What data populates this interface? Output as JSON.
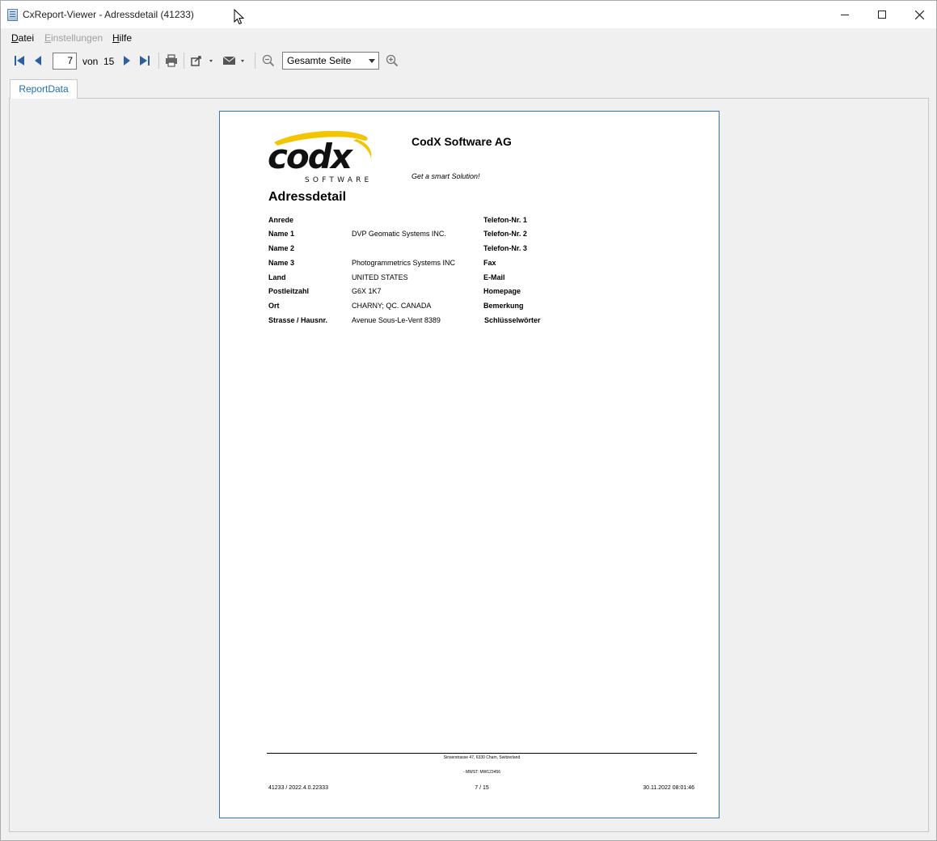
{
  "window": {
    "title": "CxReport-Viewer - Adressdetail (41233)"
  },
  "menu": {
    "datei_first": "D",
    "datei_rest": "atei",
    "einstellungen_first": "E",
    "einstellungen_rest": "instellungen",
    "hilfe_first": "H",
    "hilfe_rest": "ilfe"
  },
  "toolbar": {
    "current_page": "7",
    "von_label": "von",
    "total_pages": "15",
    "zoom_value": "Gesamte Seite",
    "icons": [
      "first-page-icon",
      "previous-page-icon",
      "next-page-icon",
      "last-page-icon",
      "print-icon",
      "export-icon",
      "email-icon",
      "zoom-out-icon",
      "zoom-in-icon"
    ]
  },
  "tabs": [
    {
      "label": "ReportData"
    }
  ],
  "report": {
    "logo_text": "codx",
    "logo_sub": "SOFTWARE",
    "company": "CodX Software AG",
    "slogan": "Get a smart Solution!",
    "title": "Adressdetail",
    "left_fields": [
      {
        "label": "Anrede",
        "value": ""
      },
      {
        "label": "Name 1",
        "value": "DVP Geomatic Systems INC."
      },
      {
        "label": "Name 2",
        "value": ""
      },
      {
        "label": "Name 3",
        "value": "Photogrammetrics Systems INC"
      },
      {
        "label": "Land",
        "value": "UNITED STATES"
      },
      {
        "label": "Postleitzahl",
        "value": "G6X 1K7"
      },
      {
        "label": "Ort",
        "value": "CHARNY; QC. CANADA"
      },
      {
        "label": "Strasse / Hausnr.",
        "value": "Avenue Sous-Le-Vent 8389"
      }
    ],
    "right_fields": [
      {
        "label": "Telefon-Nr. 1"
      },
      {
        "label": "Telefon-Nr. 2"
      },
      {
        "label": "Telefon-Nr. 3"
      },
      {
        "label": "Fax"
      },
      {
        "label": "E-Mail"
      },
      {
        "label": "Homepage"
      },
      {
        "label": "Bemerkung"
      },
      {
        "label": "Schlüsselwörter"
      }
    ],
    "footer": {
      "address": "Sinserstrasse 47, 6330 Cham, Switzerland",
      "mwst": "- MWST: MW123456",
      "left": "41233 / 2022.4.0.22333",
      "center": "7 / 15",
      "right": "30.11.2022 08:01:46"
    }
  },
  "colors": {
    "accent": "#1f6fb2",
    "page_border": "#2e77b8",
    "toolbar_icon": "#2b5f9e",
    "logo_swoosh": "#f2c500"
  }
}
